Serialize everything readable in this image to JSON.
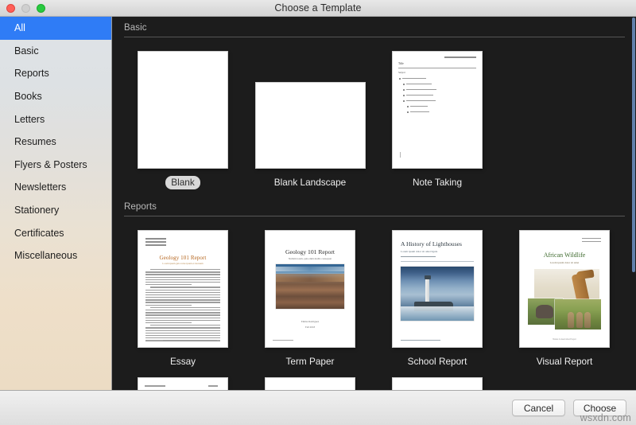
{
  "window": {
    "title": "Choose a Template",
    "controls": {
      "close": "close-button",
      "minimize": "minimize-button",
      "maximize": "maximize-button"
    }
  },
  "sidebar": {
    "items": [
      {
        "label": "All",
        "selected": true
      },
      {
        "label": "Basic",
        "selected": false
      },
      {
        "label": "Reports",
        "selected": false
      },
      {
        "label": "Books",
        "selected": false
      },
      {
        "label": "Letters",
        "selected": false
      },
      {
        "label": "Resumes",
        "selected": false
      },
      {
        "label": "Flyers & Posters",
        "selected": false
      },
      {
        "label": "Newsletters",
        "selected": false
      },
      {
        "label": "Stationery",
        "selected": false
      },
      {
        "label": "Certificates",
        "selected": false
      },
      {
        "label": "Miscellaneous",
        "selected": false
      }
    ]
  },
  "sections": [
    {
      "heading": "Basic",
      "templates": [
        {
          "name": "Blank",
          "selected": true,
          "orientation": "portrait"
        },
        {
          "name": "Blank Landscape",
          "selected": false,
          "orientation": "landscape"
        },
        {
          "name": "Note Taking",
          "selected": false,
          "orientation": "portrait"
        }
      ]
    },
    {
      "heading": "Reports",
      "templates": [
        {
          "name": "Essay",
          "selected": false,
          "orientation": "portrait"
        },
        {
          "name": "Term Paper",
          "selected": false,
          "orientation": "portrait"
        },
        {
          "name": "School Report",
          "selected": false,
          "orientation": "portrait"
        },
        {
          "name": "Visual Report",
          "selected": false,
          "orientation": "portrait"
        }
      ]
    }
  ],
  "preview_text": {
    "note_taking": {
      "title": "Title",
      "subject": "Subject"
    },
    "essay": {
      "title": "Geology 101 Report",
      "subtitle": "Lorem ipsum gula velus ipsum et monsum"
    },
    "term_paper": {
      "title": "Geology 101 Report",
      "subtitle": "Nullam lorem, quis enim mollis consequat"
    },
    "school_report": {
      "title": "A History of Lighthouses",
      "subtitle": "Lorem ipsum dolor sit amet ligula"
    },
    "visual_report": {
      "title": "African Wildlife",
      "subtitle": "Lorem ipsum dolor sit amet"
    }
  },
  "footer": {
    "cancel_label": "Cancel",
    "choose_label": "Choose",
    "watermark": "wsxdn.com"
  },
  "colors": {
    "accent": "#2f7cf6",
    "content_bg": "#1c1c1c",
    "sidebar_top": "#dfe3e7",
    "sidebar_bottom": "#ecdcc4",
    "essay_title": "#b5651d",
    "visual_title": "#3f6b2f"
  }
}
